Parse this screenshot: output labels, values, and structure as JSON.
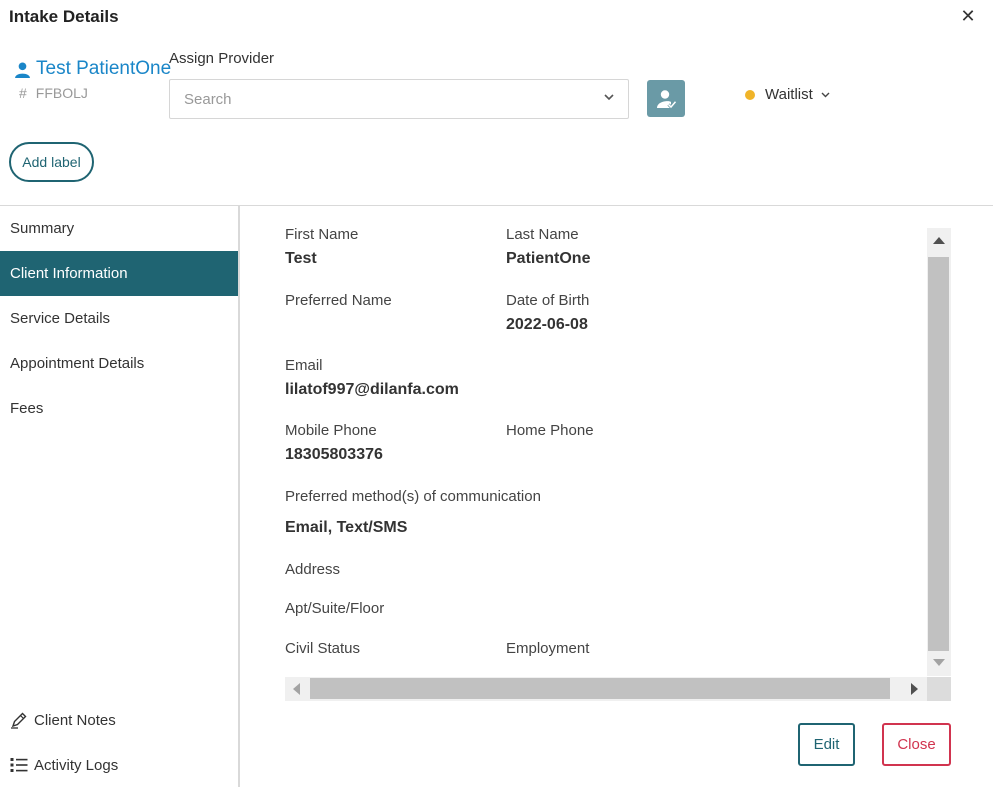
{
  "header": {
    "title": "Intake Details",
    "close_icon": "close-icon"
  },
  "patient": {
    "name": "Test PatientOne",
    "id_prefix": "#",
    "id": "FFBOLJ"
  },
  "assign": {
    "label": "Assign Provider",
    "placeholder": "Search"
  },
  "status": {
    "label": "Waitlist",
    "color": "#f0b429"
  },
  "add_label": "Add label",
  "nav": {
    "items": [
      {
        "label": "Summary"
      },
      {
        "label": "Client Information"
      },
      {
        "label": "Service Details"
      },
      {
        "label": "Appointment Details"
      },
      {
        "label": "Fees"
      }
    ],
    "active_index": 1,
    "bottom": [
      {
        "label": "Client Notes",
        "icon": "pen-icon"
      },
      {
        "label": "Activity Logs",
        "icon": "list-icon"
      }
    ]
  },
  "client": {
    "first_name": {
      "label": "First Name",
      "value": "Test"
    },
    "last_name": {
      "label": "Last Name",
      "value": "PatientOne"
    },
    "preferred_name": {
      "label": "Preferred Name",
      "value": ""
    },
    "dob": {
      "label": "Date of Birth",
      "value": "2022-06-08"
    },
    "email": {
      "label": "Email",
      "value": "lilatof997@dilanfa.com"
    },
    "mobile": {
      "label": "Mobile Phone",
      "value": "18305803376"
    },
    "home": {
      "label": "Home Phone",
      "value": ""
    },
    "comm": {
      "label": "Preferred method(s) of communication",
      "value": "Email, Text/SMS"
    },
    "address": {
      "label": "Address"
    },
    "apt": {
      "label": "Apt/Suite/Floor"
    },
    "civil": {
      "label": "Civil Status"
    },
    "employment": {
      "label": "Employment"
    }
  },
  "footer": {
    "edit": "Edit",
    "close": "Close"
  },
  "colors": {
    "accent": "#1f6472",
    "link": "#1a86c8",
    "danger": "#d1344f",
    "assign_btn": "#6a9aa6"
  }
}
